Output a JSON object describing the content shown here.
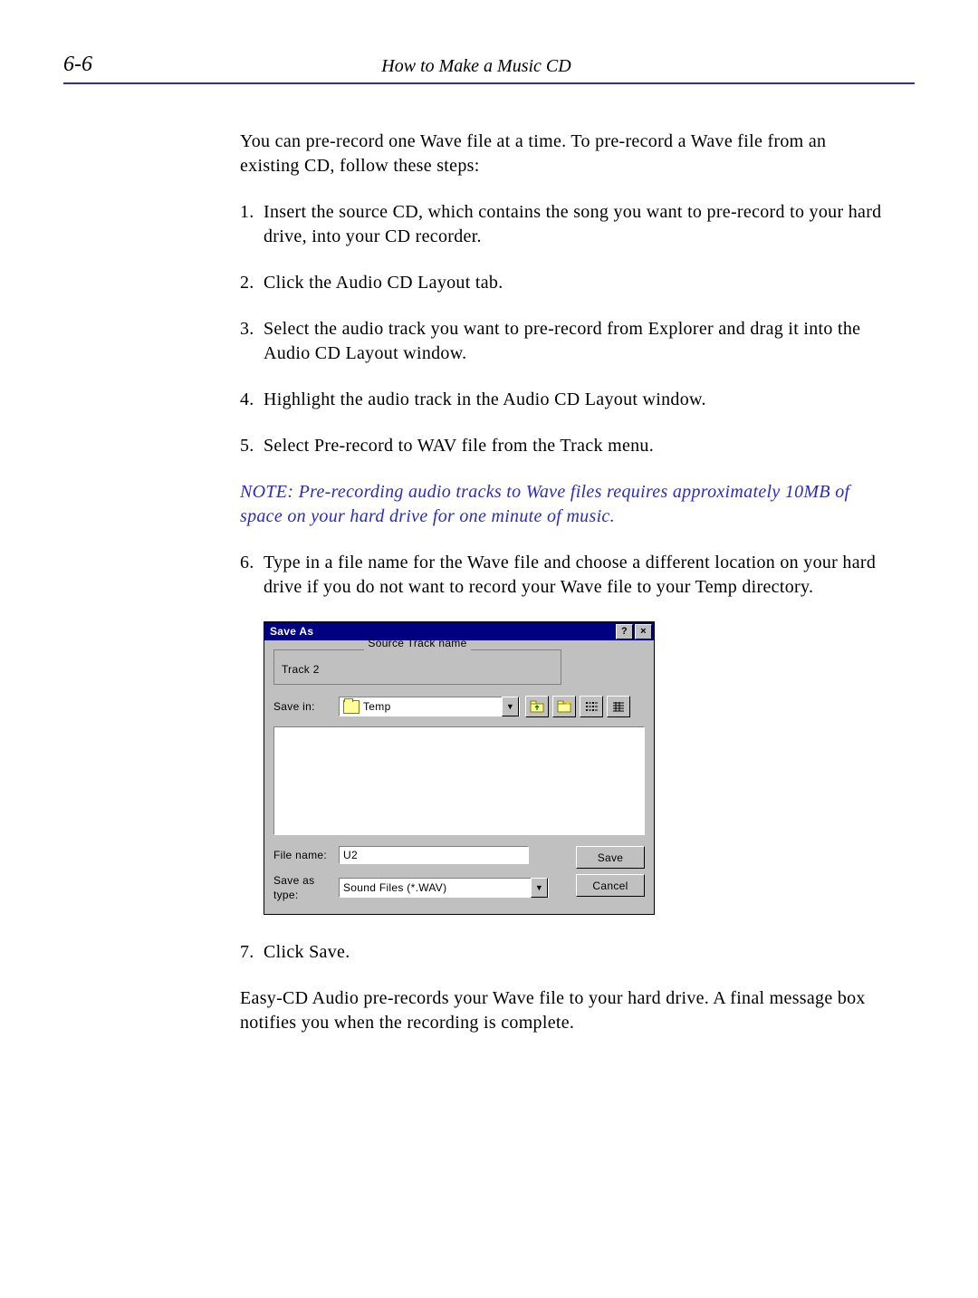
{
  "header": {
    "page_number": "6-6",
    "chapter_title": "How to Make a Music CD"
  },
  "body": {
    "intro": "You can pre-record one Wave file at a time. To pre-record a Wave file from an existing CD, follow these steps:",
    "steps": {
      "s1": "Insert the source CD, which contains the song you want to pre-record to your hard drive, into your CD recorder.",
      "s2": "Click the Audio CD Layout tab.",
      "s3": "Select the audio track you want to pre-record from Explorer and drag it into the Audio CD Layout window.",
      "s4": "Highlight the audio track in the Audio CD Layout window.",
      "s5": "Select Pre-record to WAV file from the Track menu.",
      "note": "NOTE: Pre-recording audio tracks to Wave files requires approximately 10MB of space on your hard drive for one minute of music.",
      "s6": "Type in a file name for the Wave file and choose a different location on your hard drive if you do not want to record your Wave file to your Temp directory.",
      "s7": "Click Save.",
      "after": "Easy-CD Audio pre-records your Wave file to your hard drive. A final message box notifies you when the recording is complete."
    },
    "nums": {
      "n1": "1.",
      "n2": "2.",
      "n3": "3.",
      "n4": "4.",
      "n5": "5.",
      "n6": "6.",
      "n7": "7."
    }
  },
  "dialog": {
    "title": "Save As",
    "help_glyph": "?",
    "close_glyph": "×",
    "group_legend": "Source Track name",
    "track_name": "Track 2",
    "save_in_label": "Save in:",
    "save_in_value": "Temp",
    "dd_arrow": "▼",
    "file_name_label": "File name:",
    "file_name_value": "U2",
    "save_type_label": "Save as type:",
    "save_type_value": "Sound Files (*.WAV)",
    "save_btn": "Save",
    "cancel_btn": "Cancel"
  }
}
